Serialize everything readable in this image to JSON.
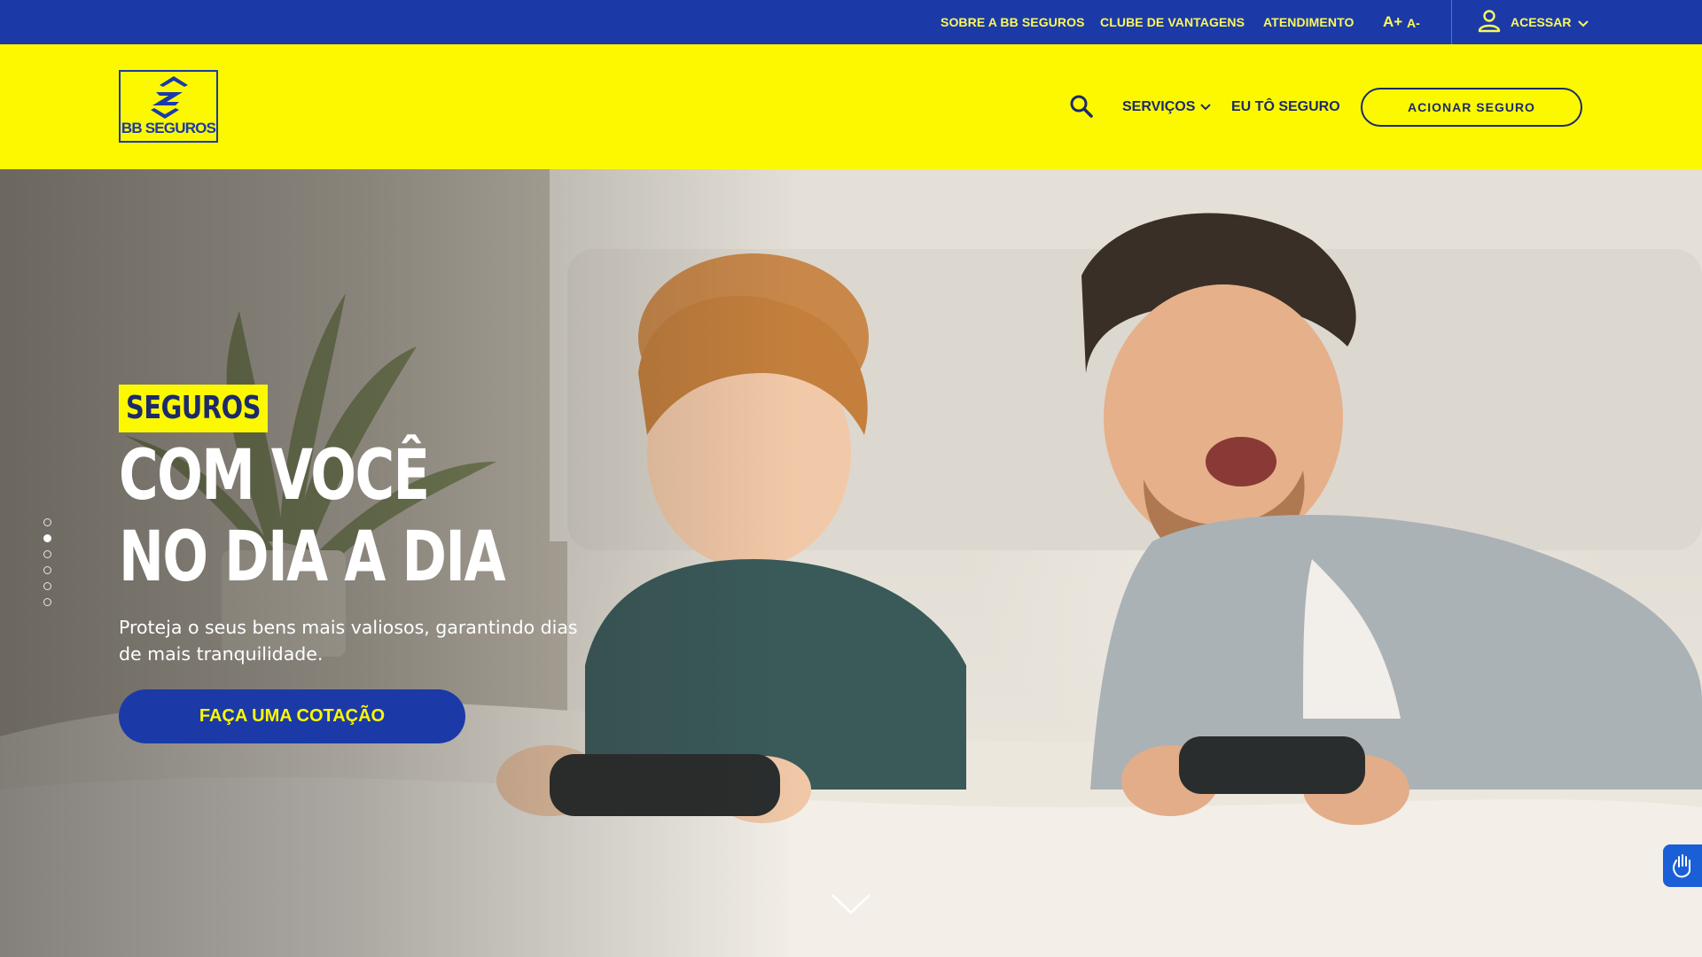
{
  "topbar": {
    "links": {
      "about": "SOBRE A BB SEGUROS",
      "club": "CLUBE DE VANTAGENS",
      "support": "ATENDIMENTO"
    },
    "font_increase": "A+",
    "font_decrease": "A-",
    "login_label": "ACESSAR",
    "icons": {
      "user": "user-icon",
      "chevron": "chevron-down-icon"
    }
  },
  "header": {
    "logo_text": "BB SEGUROS",
    "nav": {
      "services": "SERVIÇOS",
      "eu_to_seguro": "EU TÔ SEGURO"
    },
    "cta_label": "ACIONAR SEGURO",
    "icons": {
      "search": "search-icon"
    }
  },
  "hero": {
    "badge": "SEGUROS",
    "headline_line1": "COM VOCÊ",
    "headline_line2": "NO DIA A DIA",
    "subtitle": "Proteja o seus bens mais valiosos, garantindo dias de mais tranquilidade.",
    "cta_label": "FAÇA UMA COTAÇÃO",
    "slides": {
      "count": 6,
      "active_index": 1
    }
  },
  "colors": {
    "brand_blue": "#1b3aa8",
    "brand_yellow": "#fcf800",
    "nav_text": "#1b2a6b",
    "accessibility_blue": "#1b5fd6"
  }
}
